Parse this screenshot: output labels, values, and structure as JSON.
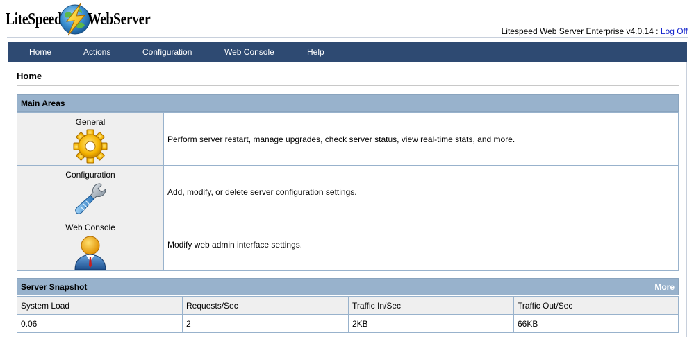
{
  "header": {
    "logo_left": "LiteSpeed",
    "logo_right": "WebServer",
    "version_text": "Litespeed Web Server Enterprise v4.0.14 : ",
    "logoff_label": "Log Off"
  },
  "nav": {
    "items": [
      {
        "label": "Home"
      },
      {
        "label": "Actions"
      },
      {
        "label": "Configuration"
      },
      {
        "label": "Web Console"
      },
      {
        "label": "Help"
      }
    ]
  },
  "page": {
    "title": "Home"
  },
  "main_areas": {
    "header": "Main Areas",
    "items": [
      {
        "name": "General",
        "icon": "gear-icon",
        "description": "Perform server restart, manage upgrades, check server status, view real-time stats, and more."
      },
      {
        "name": "Configuration",
        "icon": "wrench-icon",
        "description": "Add, modify, or delete server configuration settings."
      },
      {
        "name": "Web Console",
        "icon": "user-icon",
        "description": "Modify web admin interface settings."
      }
    ]
  },
  "snapshot": {
    "header": "Server Snapshot",
    "more_label": "More",
    "columns": [
      "System Load",
      "Requests/Sec",
      "Traffic In/Sec",
      "Traffic Out/Sec"
    ],
    "values": [
      "0.06",
      "2",
      "2KB",
      "66KB"
    ]
  },
  "colors": {
    "nav_bg": "#2e4a72",
    "section_header_bg": "#98b2cc",
    "area_cell_bg": "#efefef",
    "link": "#1122cc"
  }
}
